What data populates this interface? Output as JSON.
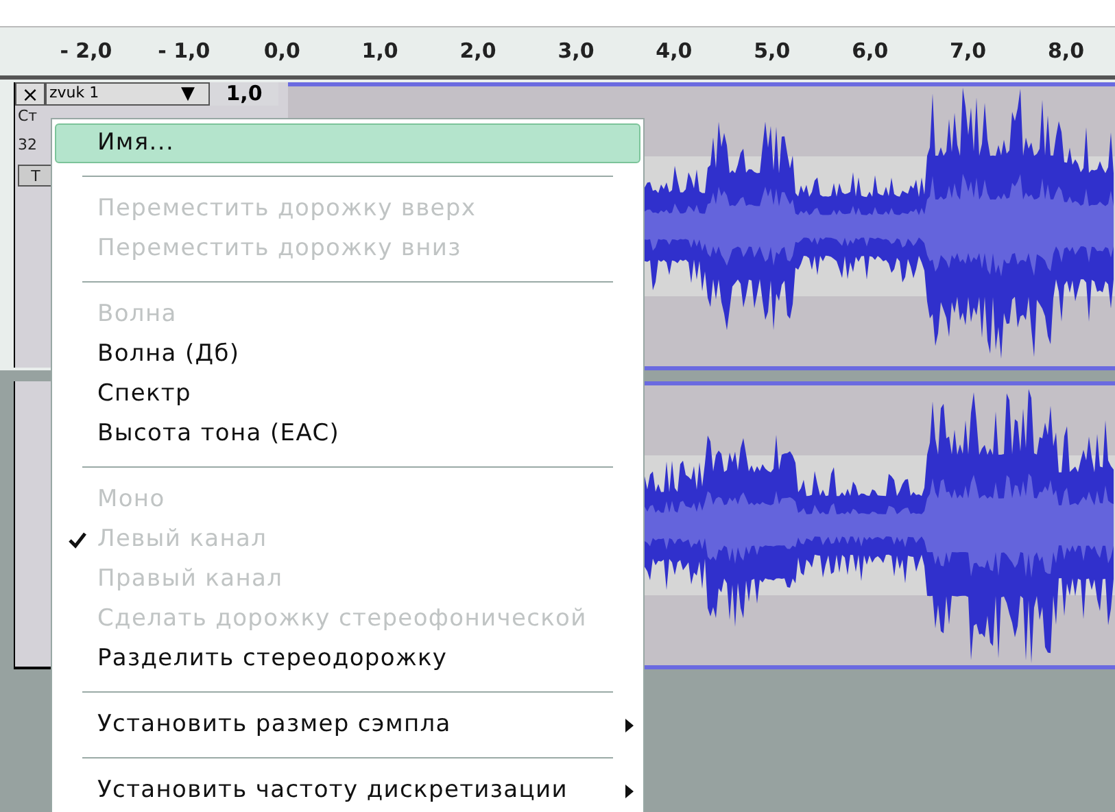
{
  "ruler": {
    "labels": [
      "- 2,0",
      "- 1,0",
      "0,0",
      "1,0",
      "2,0",
      "3,0",
      "4,0",
      "5,0",
      "6,0",
      "7,0",
      "8,0"
    ]
  },
  "track": {
    "close": "×",
    "name": "zvuk 1",
    "dropdown": "▼",
    "gain": "1,0",
    "info": [
      "Ст",
      "32"
    ],
    "button": "Т"
  },
  "menu": {
    "items": [
      {
        "kind": "item",
        "label": "Имя...",
        "selected": true,
        "disabled": false,
        "checked": false,
        "submenu": false
      },
      {
        "kind": "separator"
      },
      {
        "kind": "item",
        "label": "Переместить дорожку вверх",
        "selected": false,
        "disabled": true,
        "checked": false,
        "submenu": false
      },
      {
        "kind": "item",
        "label": "Переместить дорожку вниз",
        "selected": false,
        "disabled": true,
        "checked": false,
        "submenu": false
      },
      {
        "kind": "separator"
      },
      {
        "kind": "item",
        "label": "Волна",
        "selected": false,
        "disabled": true,
        "checked": false,
        "submenu": false
      },
      {
        "kind": "item",
        "label": "Волна (Дб)",
        "selected": false,
        "disabled": false,
        "checked": false,
        "submenu": false
      },
      {
        "kind": "item",
        "label": "Спектр",
        "selected": false,
        "disabled": false,
        "checked": false,
        "submenu": false
      },
      {
        "kind": "item",
        "label": "Высота тона (EAC)",
        "selected": false,
        "disabled": false,
        "checked": false,
        "submenu": false
      },
      {
        "kind": "separator"
      },
      {
        "kind": "item",
        "label": "Моно",
        "selected": false,
        "disabled": true,
        "checked": false,
        "submenu": false
      },
      {
        "kind": "item",
        "label": "Левый канал",
        "selected": false,
        "disabled": true,
        "checked": true,
        "submenu": false
      },
      {
        "kind": "item",
        "label": "Правый канал",
        "selected": false,
        "disabled": true,
        "checked": false,
        "submenu": false
      },
      {
        "kind": "item",
        "label": "Сделать дорожку стереофонической",
        "selected": false,
        "disabled": true,
        "checked": false,
        "submenu": false
      },
      {
        "kind": "item",
        "label": "Разделить стереодорожку",
        "selected": false,
        "disabled": false,
        "checked": false,
        "submenu": false
      },
      {
        "kind": "separator"
      },
      {
        "kind": "item",
        "label": "Установить размер сэмпла",
        "selected": false,
        "disabled": false,
        "checked": false,
        "submenu": true
      },
      {
        "kind": "separator"
      },
      {
        "kind": "item",
        "label": "Установить частоту дискретизации",
        "selected": false,
        "disabled": false,
        "checked": false,
        "submenu": true
      }
    ]
  }
}
